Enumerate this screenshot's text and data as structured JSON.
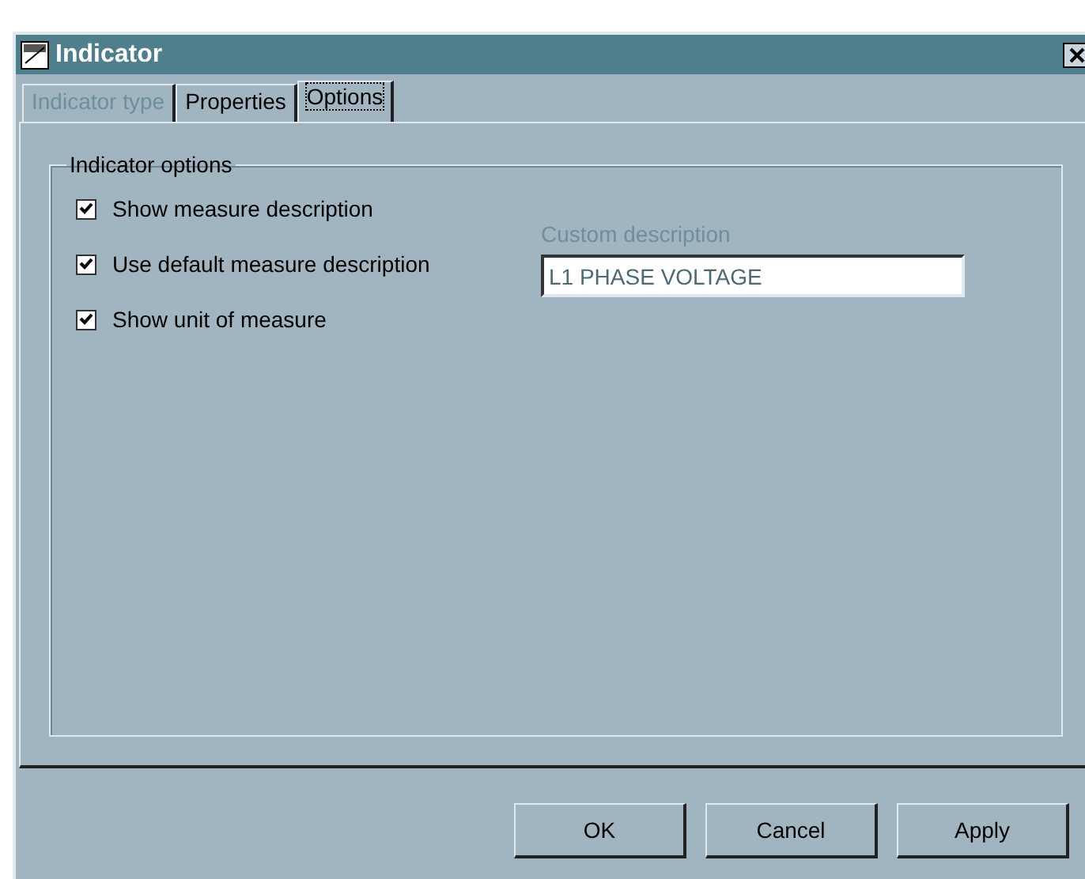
{
  "window": {
    "title": "Indicator"
  },
  "tabs": [
    {
      "label": "Indicator type",
      "selected": false,
      "disabled": true
    },
    {
      "label": "Properties",
      "selected": false,
      "disabled": false
    },
    {
      "label": "Options",
      "selected": true,
      "disabled": false
    }
  ],
  "group": {
    "title": "Indicator options",
    "checkboxes": [
      {
        "label": "Show measure description",
        "checked": true
      },
      {
        "label": "Use default measure description",
        "checked": true
      },
      {
        "label": "Show unit of measure",
        "checked": true
      }
    ],
    "custom_description": {
      "label": "Custom description",
      "value": "L1 PHASE VOLTAGE",
      "disabled": true
    }
  },
  "buttons": [
    "OK",
    "Cancel",
    "Apply"
  ]
}
